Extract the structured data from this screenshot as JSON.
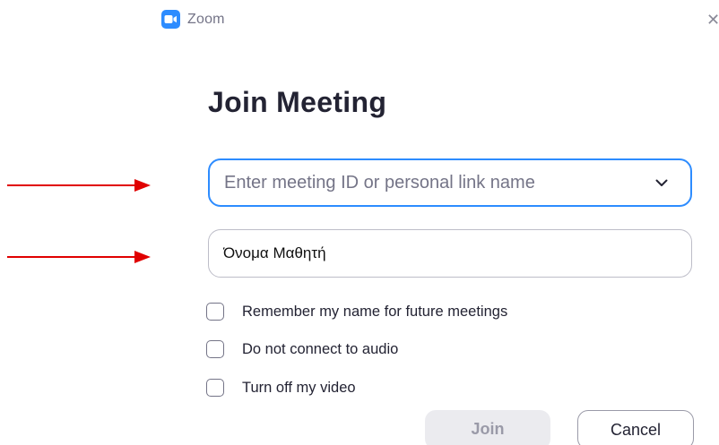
{
  "window": {
    "app_title": "Zoom",
    "app_icon": "zoom-camera-icon",
    "close_icon": "close-icon",
    "accent_color": "#2D8CFF"
  },
  "heading": "Join Meeting",
  "meeting_id": {
    "value": "",
    "placeholder": "Enter meeting ID or personal link name",
    "dropdown_icon": "chevron-down-icon"
  },
  "name_field": {
    "value": "Όνομα Μαθητή",
    "placeholder": ""
  },
  "options": [
    {
      "label": "Remember my name for future meetings",
      "checked": false
    },
    {
      "label": "Do not connect to audio",
      "checked": false
    },
    {
      "label": "Turn off my video",
      "checked": false
    }
  ],
  "buttons": {
    "join": "Join",
    "cancel": "Cancel"
  },
  "annotations": {
    "arrow_color": "#E00000"
  }
}
